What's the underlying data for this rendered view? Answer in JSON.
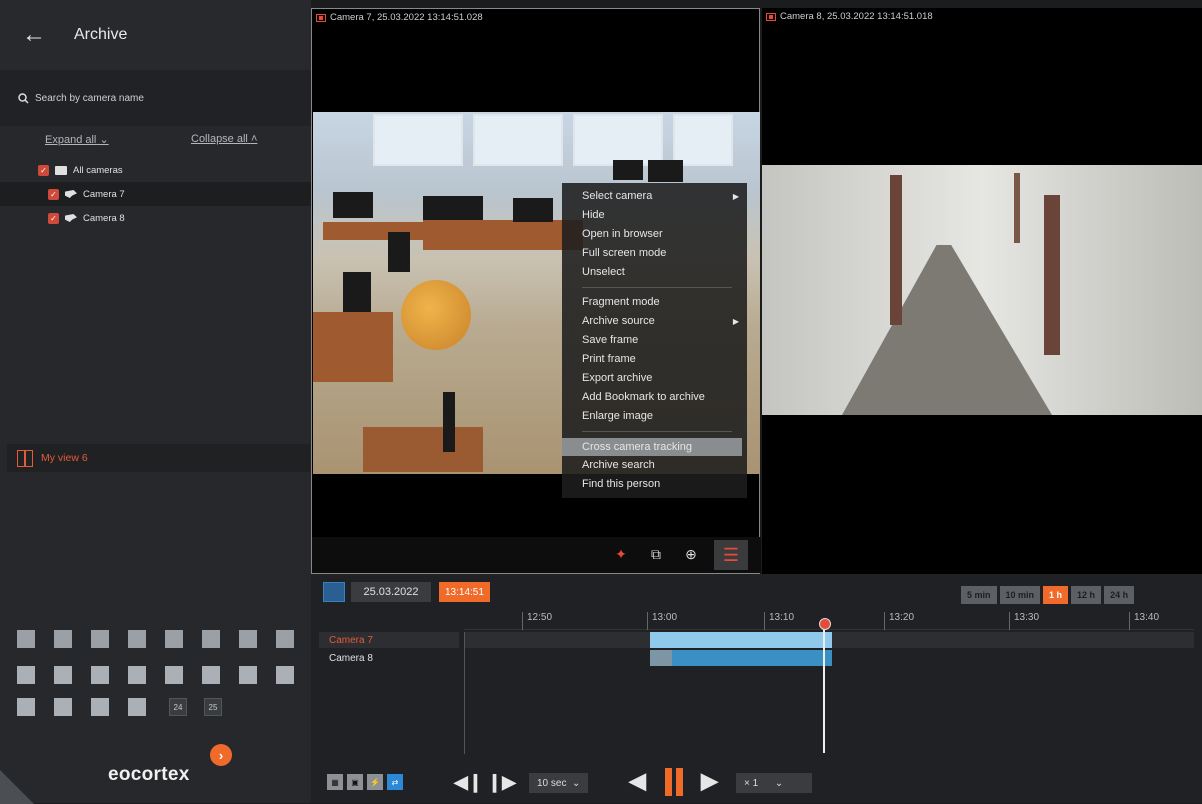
{
  "sidebar": {
    "title": "Archive",
    "search_placeholder": "Search by camera name",
    "expand_all": "Expand all",
    "collapse_all": "Collapse all",
    "tree": {
      "root": "All cameras",
      "cameras": [
        "Camera 7",
        "Camera 8"
      ]
    },
    "view_name": "My view 6",
    "layout_numbers": [
      "24",
      "25"
    ],
    "logo": "eocortex"
  },
  "cameras": {
    "cam7_label": "Camera 7, 25.03.2022 13:14:51.028",
    "cam8_label": "Camera 8, 25.03.2022 13:14:51.018"
  },
  "context_menu": {
    "items": [
      "Select camera",
      "Hide",
      "Open in browser",
      "Full screen mode",
      "Unselect",
      "Fragment mode",
      "Archive source",
      "Save frame",
      "Print frame",
      "Export archive",
      "Add Bookmark to archive",
      "Enlarge image",
      "Cross camera tracking",
      "Archive search",
      "Find this person"
    ],
    "selected": "Cross camera tracking"
  },
  "timeline": {
    "date": "25.03.2022",
    "time": "13:14:51",
    "scales": [
      "5 min",
      "10 min",
      "1 h",
      "12 h",
      "24 h"
    ],
    "active_scale": "1 h",
    "ticks": [
      "12:50",
      "13:00",
      "13:10",
      "13:20",
      "13:30",
      "13:40"
    ],
    "rows": [
      "Camera 7",
      "Camera 8"
    ],
    "step": "10 sec",
    "speed": "× 1"
  },
  "colors": {
    "accent": "#f06b2a",
    "record": "#e84a3a",
    "track_cam7": "#8fc9ec",
    "track_cam8": "#3a8fc4"
  }
}
